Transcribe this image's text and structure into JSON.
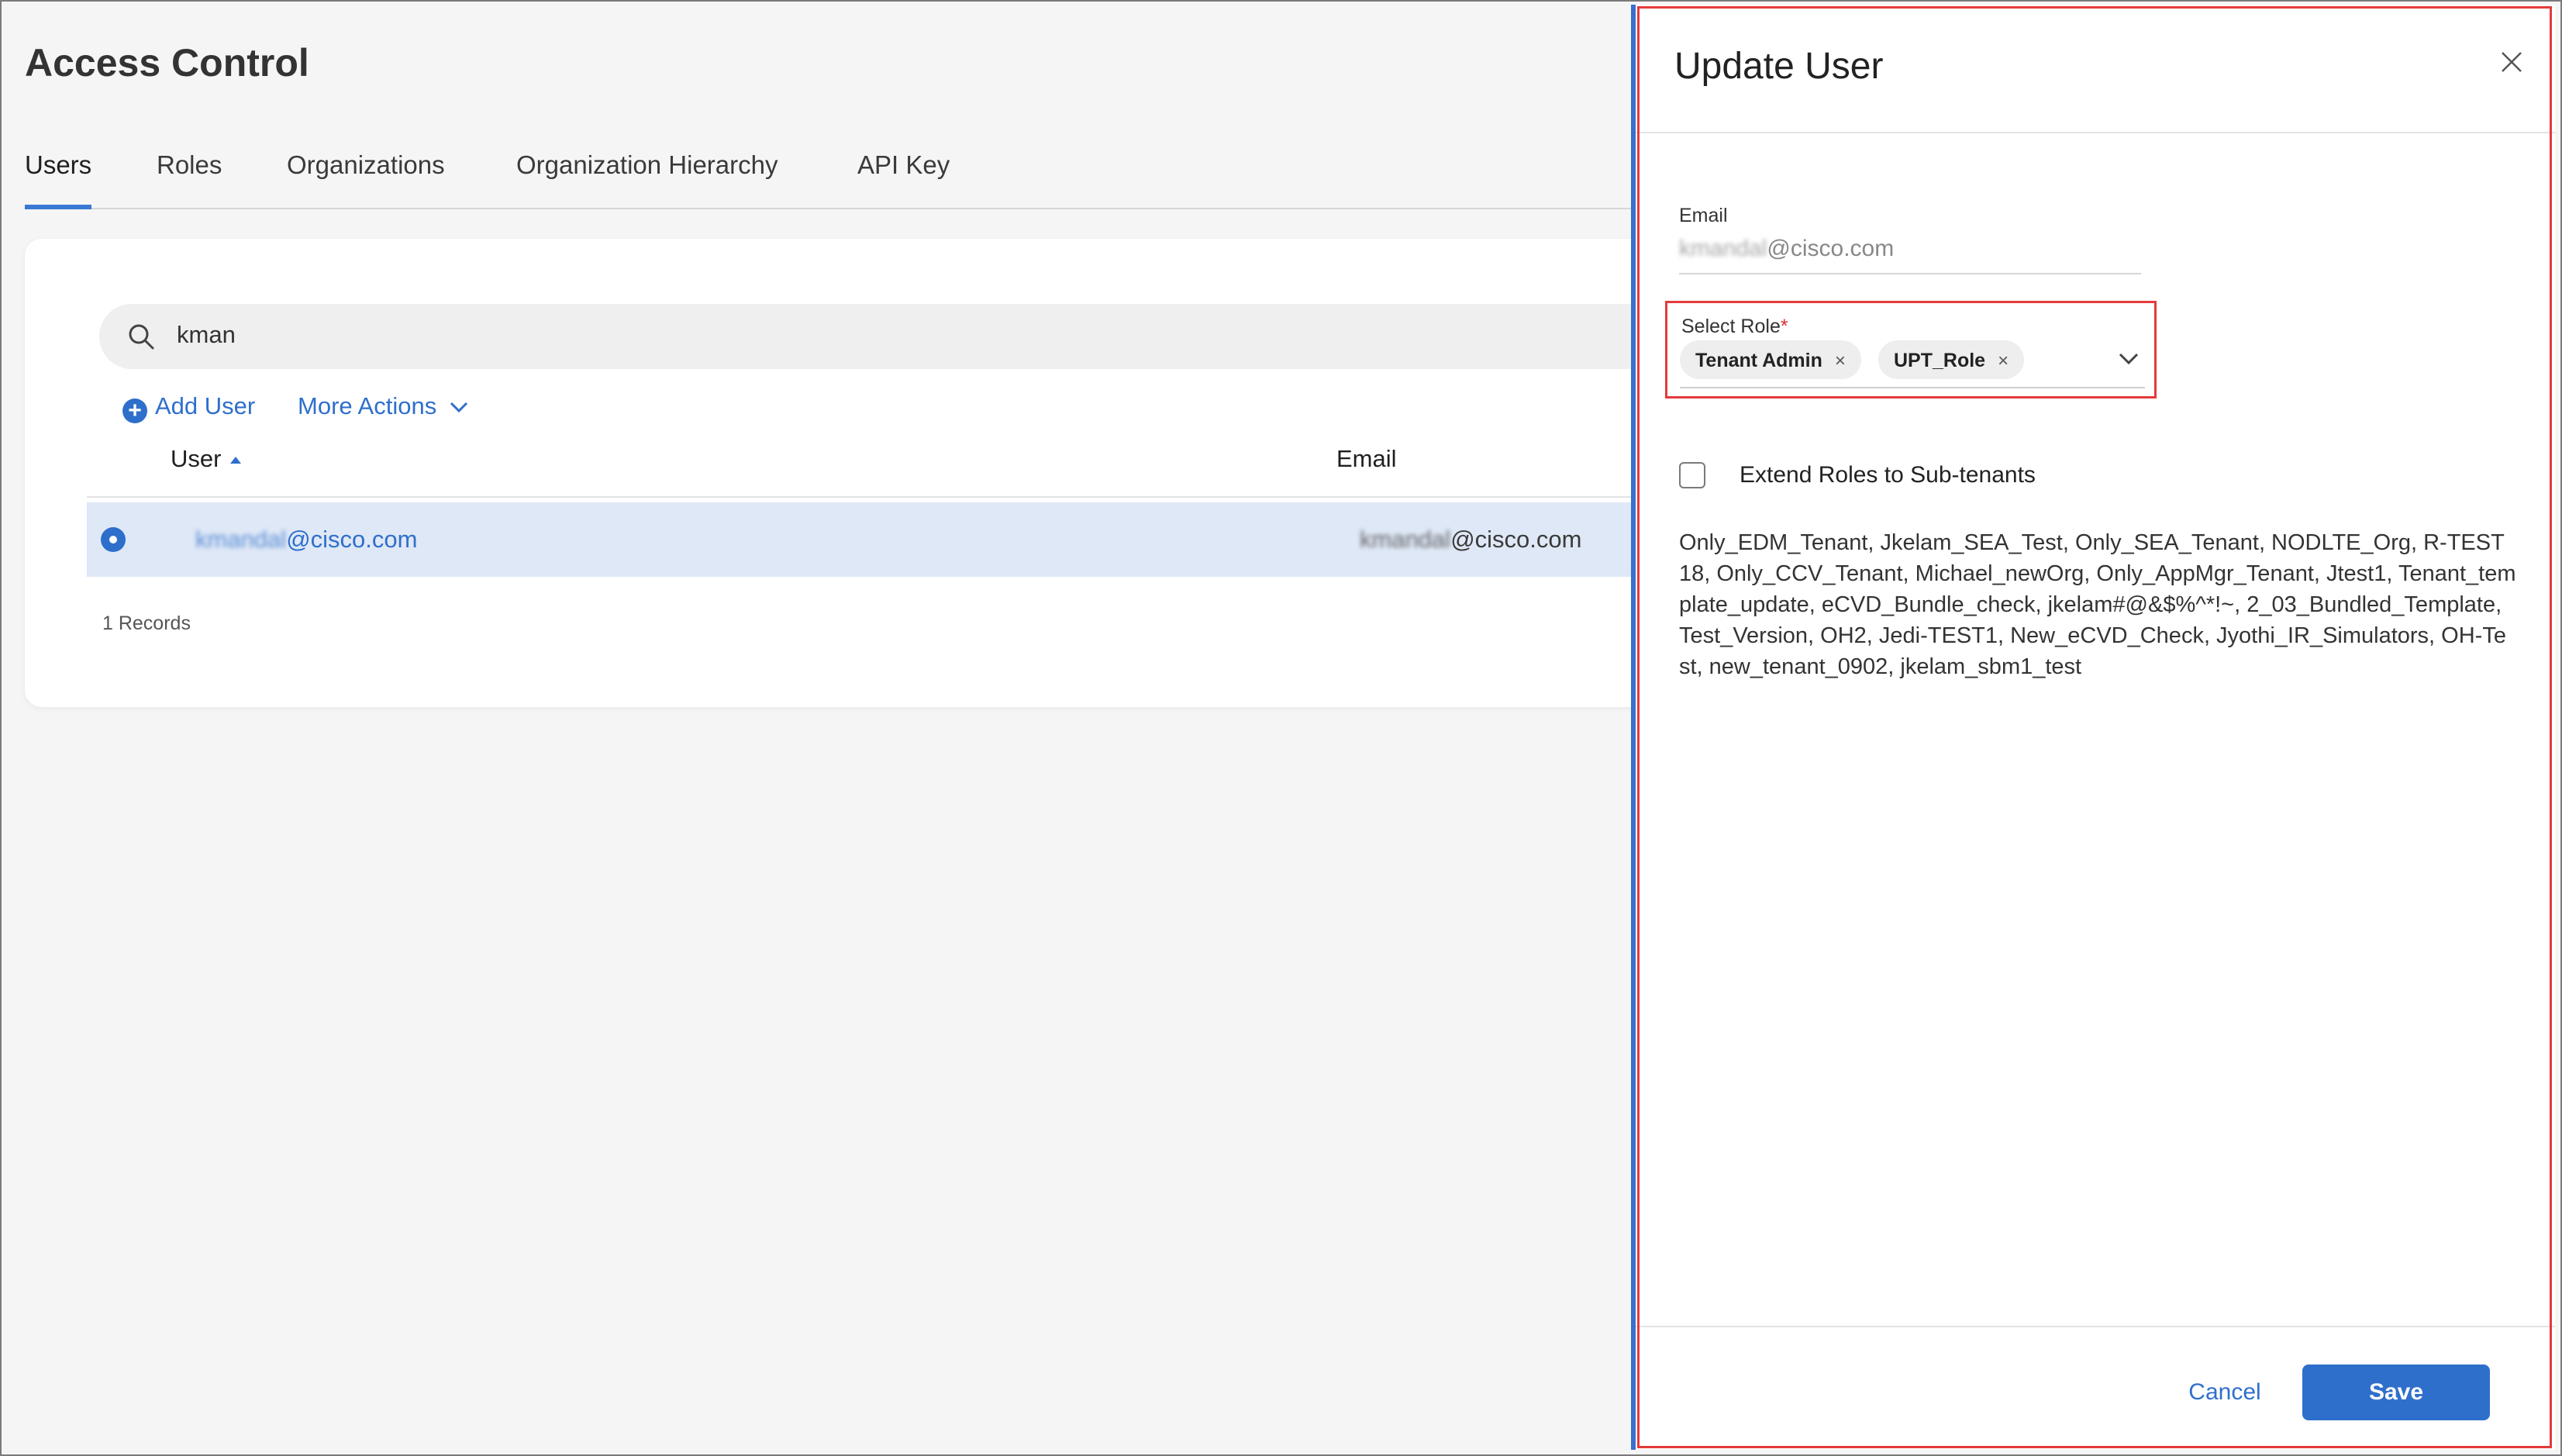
{
  "page": {
    "title": "Access Control"
  },
  "tabs": [
    {
      "label": "Users",
      "active": true
    },
    {
      "label": "Roles"
    },
    {
      "label": "Organizations"
    },
    {
      "label": "Organization Hierarchy"
    },
    {
      "label": "API Key"
    }
  ],
  "search": {
    "value": "kman"
  },
  "actions": {
    "add_user": "Add User",
    "more_actions": "More Actions"
  },
  "table": {
    "columns": [
      "User",
      "Email"
    ],
    "rows": [
      {
        "user_blurred": "kmandal",
        "user_domain": "@cisco.com",
        "email_blurred": "kmandal",
        "email_domain": "@cisco.com"
      }
    ],
    "records": "1 Records"
  },
  "drawer": {
    "title": "Update User",
    "email_label": "Email",
    "email_blurred": "kmandal",
    "email_domain": "@cisco.com",
    "role_label": "Select Role",
    "role_required": "*",
    "roles": [
      {
        "label": "Tenant Admin",
        "remove": "×"
      },
      {
        "label": "UPT_Role",
        "remove": "×"
      }
    ],
    "extend_label": "Extend Roles to Sub-tenants",
    "organizations": " Only_EDM_Tenant, Jkelam_SEA_Test, Only_SEA_Tenant, NODLTE_Org, R-TEST18, Only_CCV_Tenant, Michael_newOrg, Only_AppMgr_Tenant, Jtest1, Tenant_template_update, eCVD_Bundle_check, jkelam#@&$%^*!~, 2_03_Bundled_Template, Test_Version, OH2, Jedi-TEST1, New_eCVD_Check, Jyothi_IR_Simulators, OH-Test, new_tenant_0902, jkelam_sbm1_test",
    "cancel": "Cancel",
    "save": "Save"
  },
  "colors": {
    "accent": "#2f6fcc",
    "highlight_outline": "#e53a3a",
    "selected_row": "#dfe8f6"
  }
}
